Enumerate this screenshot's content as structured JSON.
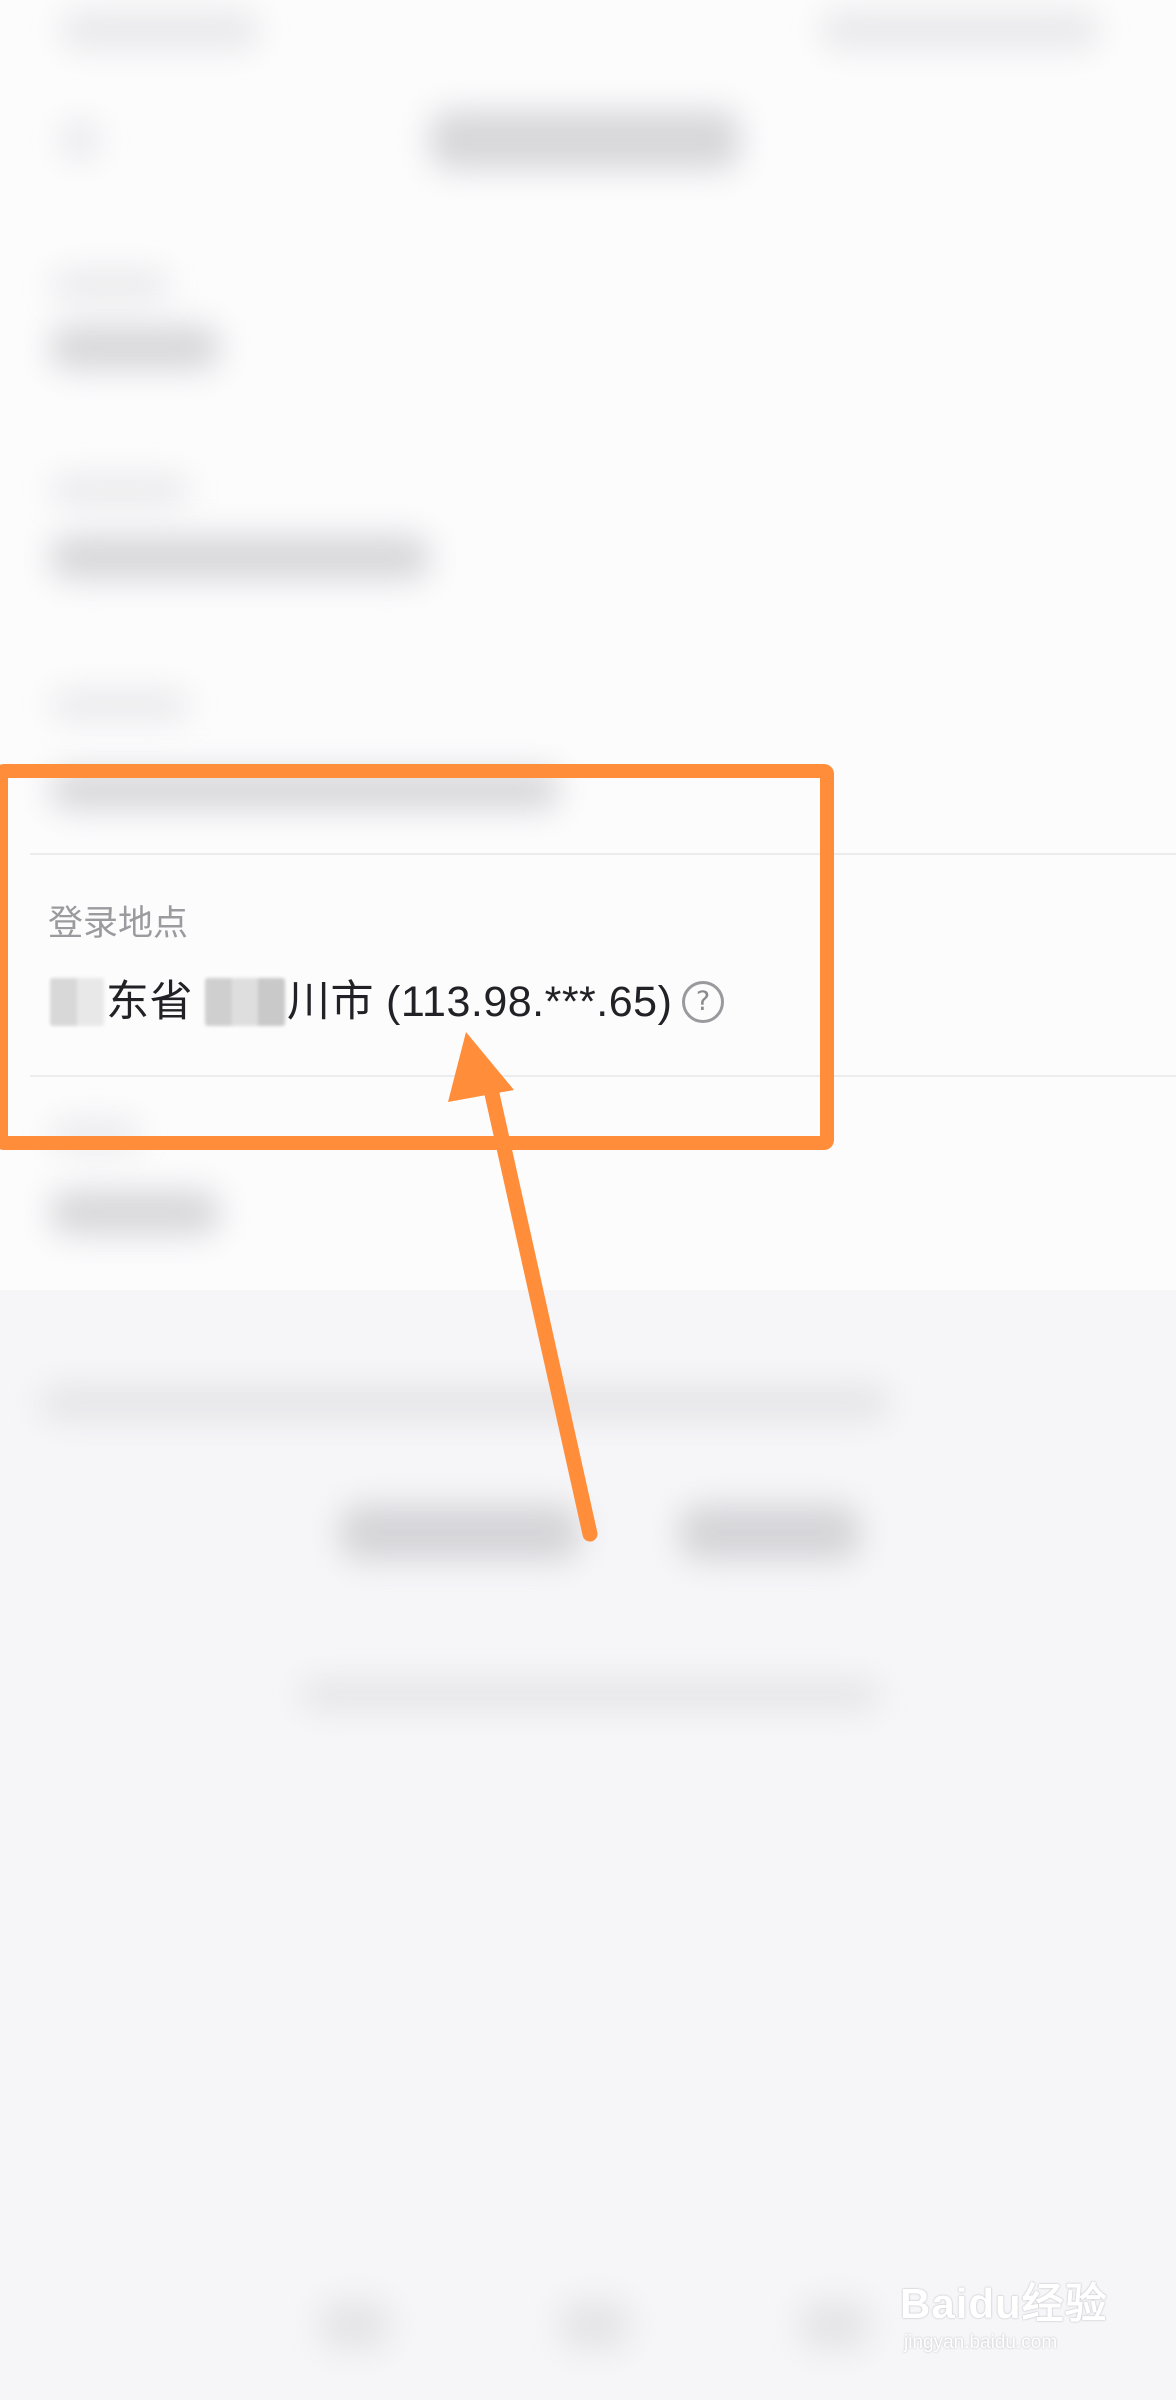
{
  "login_location": {
    "label": "登录地点",
    "province_suffix": "东省",
    "city_suffix": "川市",
    "ip": "(113.98.***.65)"
  },
  "help_icon": {
    "name": "question-circle-icon",
    "glyph": "?"
  },
  "annotation": {
    "color": "#ff8d3a"
  },
  "watermark": {
    "main": "Baidu经验",
    "sub": "jingyan.baidu.com"
  }
}
